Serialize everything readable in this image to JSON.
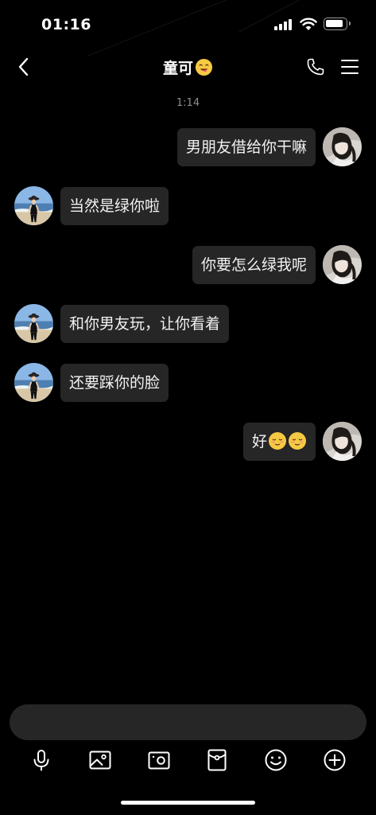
{
  "status_bar": {
    "time": "01:16",
    "icons": [
      "signal-icon",
      "wifi-icon",
      "battery-icon"
    ]
  },
  "nav": {
    "title": "童可",
    "title_emoji": "smiling-face-emoji",
    "left_icon": "back-chevron-icon",
    "right_icons": [
      "phone-icon",
      "menu-icon"
    ]
  },
  "chat": {
    "timestamp": "1:14",
    "messages": [
      {
        "direction": "outgoing",
        "text": "男朋友借给你干嘛"
      },
      {
        "direction": "incoming",
        "text": "当然是绿你啦"
      },
      {
        "direction": "outgoing",
        "text": "你要怎么绿我呢"
      },
      {
        "direction": "incoming",
        "text": "和你男友玩，让你看着"
      },
      {
        "direction": "incoming",
        "text": "还要踩你的脸"
      },
      {
        "direction": "outgoing",
        "text": "好",
        "emojis": [
          "relieved-face-emoji",
          "relieved-face-emoji"
        ]
      }
    ]
  },
  "input": {
    "placeholder": ""
  },
  "toolbar": {
    "items": [
      "microphone-icon",
      "image-icon",
      "camera-icon",
      "red-packet-icon",
      "emoji-icon",
      "plus-icon"
    ]
  },
  "colors": {
    "background": "#000000",
    "bubble": "#262626",
    "timestamp": "#8d8d8d",
    "emoji": "#f6c944"
  }
}
